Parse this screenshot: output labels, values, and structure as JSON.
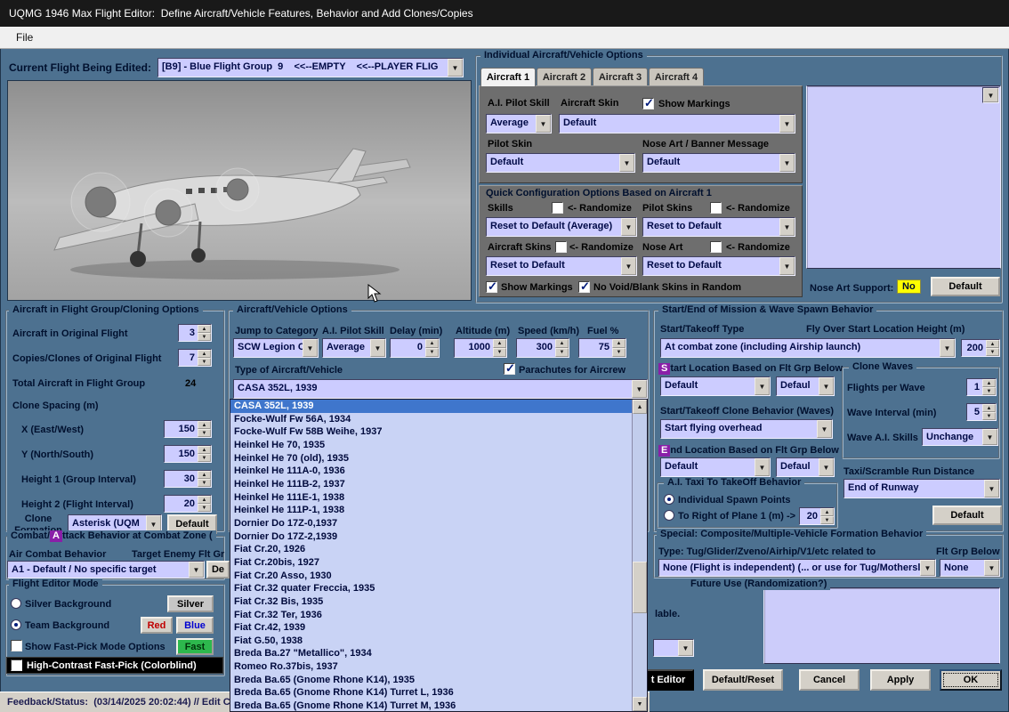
{
  "colors": {
    "background_blue": "#4d7190",
    "field_lavender": "#ccccff",
    "panel_grey": "#6e6e6e",
    "selection_blue": "#3f76cc",
    "badge_yellow": "#ffff00",
    "fast_green": "#2db84d",
    "hotkey_purple": "#8a1fa8",
    "titlebar_black": "#191919"
  },
  "window": {
    "title": "UQMG 1946 Max Flight Editor:  Define Aircraft/Vehicle Features, Behavior and Add Clones/Copies",
    "menu_file": "File"
  },
  "current_flight": {
    "label": "Current Flight Being Edited:",
    "value": "[B9] - Blue Flight Group  9    <<--EMPTY    <<--PLAYER FLIG"
  },
  "individual": {
    "title": "Individual Aircraft/Vehicle Options",
    "tabs": [
      {
        "label": "Aircraft 1"
      },
      {
        "label": "Aircraft 2"
      },
      {
        "label": "Aircraft 3"
      },
      {
        "label": "Aircraft 4"
      }
    ],
    "ai_pilot_skill_label": "A.I. Pilot Skill",
    "aircraft_skin_label": "Aircraft Skin",
    "show_markings_label": "Show Markings",
    "ai_pilot_skill_value": "Average",
    "aircraft_skin_value": "Default",
    "pilot_skin_label": "Pilot Skin",
    "nose_art_banner_label": "Nose Art / Banner Message",
    "pilot_skin_value": "Default",
    "nose_art_banner_value": "Default"
  },
  "quick_config": {
    "title": "Quick Configuration Options Based on Aircraft 1",
    "skills_label": "Skills",
    "randomize": "<- Randomize",
    "pilot_skins_label": "Pilot Skins",
    "skills_reset": "Reset to Default (Average)",
    "pilot_skins_reset": "Reset to Default",
    "aircraft_skins_label": "Aircraft Skins",
    "nose_art_label": "Nose Art",
    "aircraft_skins_reset": "Reset to Default",
    "nose_art_reset": "Reset to Default",
    "show_markings_label": "Show Markings",
    "no_void_label": "No Void/Blank Skins in Random"
  },
  "nose_art_support": {
    "label": "Nose Art Support:",
    "value": "No",
    "default_button": "Default"
  },
  "cloning": {
    "title": "Aircraft in Flight Group/Cloning Options",
    "original_label": "Aircraft in Original Flight",
    "original_value": "3",
    "copies_label": "Copies/Clones of Original Flight",
    "copies_value": "7",
    "total_label": "Total Aircraft in Flight Group",
    "total_value": "24",
    "spacing_title": "Clone Spacing (m)",
    "x_label": "X (East/West)",
    "x_value": "150",
    "y_label": "Y (North/South)",
    "y_value": "150",
    "h1_label": "Height 1 (Group Interval)",
    "h1_value": "30",
    "h2_label": "Height 2 (Flight Interval)",
    "h2_value": "20",
    "formation_label": "Clone Formation",
    "formation_value": "Asterisk (UQM",
    "default_button": "Default"
  },
  "vehicle": {
    "title": "Aircraft/Vehicle Options",
    "jump_label": "Jump to Category",
    "jump_value": "SCW Legion Co",
    "skill_label": "A.I. Pilot Skill",
    "skill_value": "Average",
    "delay_label": "Delay (min)",
    "delay_value": "0",
    "alt_label": "Altitude (m)",
    "alt_value": "1000",
    "speed_label": "Speed (km/h)",
    "speed_value": "300",
    "fuel_label": "Fuel %",
    "fuel_value": "75",
    "type_label": "Type of Aircraft/Vehicle",
    "parachutes_label": "Parachutes for Aircrew",
    "type_value": "CASA 352L, 1939"
  },
  "aircraft_list": {
    "selected_index": 0,
    "items": [
      "CASA 352L, 1939",
      "Focke-Wulf Fw 56A, 1934",
      "Focke-Wulf Fw 58B Weihe, 1937",
      "Heinkel He 70, 1935",
      "Heinkel He 70 (old), 1935",
      "Heinkel He 111A-0, 1936",
      "Heinkel He 111B-2, 1937",
      "Heinkel He 111E-1, 1938",
      "Heinkel He 111P-1, 1938",
      "Dornier Do 17Z-0,1937",
      "Dornier Do 17Z-2,1939",
      "Fiat Cr.20, 1926",
      "Fiat Cr.20bis, 1927",
      "Fiat Cr.20 Asso, 1930",
      "Fiat Cr.32 quater Freccia, 1935",
      "Fiat Cr.32 Bis, 1935",
      "Fiat Cr.32 Ter, 1936",
      "Fiat Cr.42, 1939",
      "Fiat G.50, 1938",
      "Breda Ba.27 \"Metallico\", 1934",
      "Romeo Ro.37bis, 1937",
      "Breda Ba.65 (Gnome Rhone K14), 1935",
      "Breda Ba.65 (Gnome Rhone K14) Turret L, 1936",
      "Breda Ba.65 (Gnome Rhone K14) Turret M, 1936"
    ]
  },
  "startend": {
    "title": "Start/End of Mission & Wave Spawn Behavior",
    "start_type_label": "Start/Takeoff Type",
    "flyover_label": "Fly Over Start Location Height (m)",
    "start_type_value": "At combat zone (including Airship launch)",
    "flyover_value": "200",
    "start_loc_hotkey": "S",
    "start_loc_label": "tart Location Based on Flt Grp Below",
    "start_loc_value": "Default",
    "start_loc_value2": "Defaul",
    "clone_behavior_label": "Start/Takeoff Clone Behavior (Waves)",
    "clone_behavior_value": "Start flying overhead",
    "end_loc_hotkey": "E",
    "end_loc_label": "nd Location Based on Flt Grp Below",
    "end_loc_value": "Default",
    "end_loc_value2": "Defaul",
    "taxi_title": "A.I. Taxi To TakeOff Behavior",
    "radio_individual": "Individual Spawn Points",
    "radio_right": "To Right of Plane 1 (m) ->",
    "radio_right_value": "20",
    "clone_waves_title": "Clone Waves",
    "flights_label": "Flights per Wave",
    "flights_value": "1",
    "interval_label": "Wave Interval (min)",
    "interval_value": "5",
    "wave_skills_label": "Wave A.I. Skills",
    "wave_skills_value": "Unchange",
    "taxi_distance_label": "Taxi/Scramble Run Distance",
    "taxi_distance_value": "End of Runway",
    "default_button": "Default"
  },
  "combat": {
    "title_pre": "Combat/",
    "hotkey": "A",
    "title_post": "ttack Behavior at Combat Zone (",
    "air_label": "Air Combat Behavior",
    "target_label": "Target Enemy Flt Gr",
    "value": "A1 - Default / No specific target",
    "partial_button": "De"
  },
  "editor_mode": {
    "title": "Flight Editor Mode",
    "silver_label": "Silver Background",
    "silver_button": "Silver",
    "team_label": "Team Background",
    "red_button": "Red",
    "blue_button": "Blue",
    "fastpick_label": "Show Fast-Pick Mode Options",
    "fast_button": "Fast",
    "highcontrast_label": "High-Contrast Fast-Pick (Colorblind)"
  },
  "special": {
    "title": "Special: Composite/Multiple-Vehicle Formation Behavior",
    "type_label": "Type: Tug/Glider/Zveno/Airhip/V1/etc related to",
    "flt_grp_label": "Flt Grp Below",
    "type_value": "None (Flight is independent) (... or use for Tug/Mothersl",
    "flt_grp_value": "None"
  },
  "future": {
    "title": "Future Use (Randomization?)",
    "partial_text": "lable."
  },
  "footer": {
    "partial_button": "t Editor",
    "default_reset": "Default/Reset",
    "cancel": "Cancel",
    "apply": "Apply",
    "ok": "OK"
  },
  "status": {
    "text": "Feedback/Status:  (03/14/2025 20:02:44) // Edit C"
  }
}
